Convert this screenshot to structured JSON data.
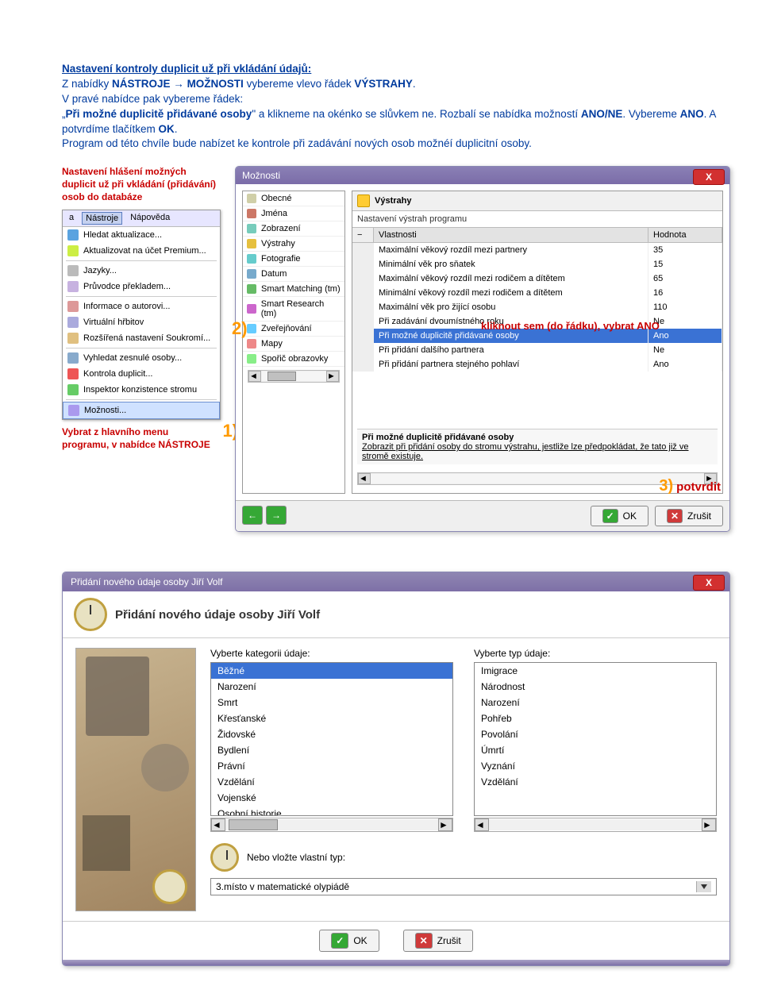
{
  "instructions": {
    "title": "Nastavení kontroly duplicit už při vkládání údajů:",
    "line1a": "Z nabídky ",
    "bold1": "NÁSTROJE",
    "arrow": " → ",
    "bold2": "MOŽNOSTI",
    "line1b": " vybereme vlevo řádek ",
    "bold3": "VÝSTRAHY",
    "line1c": ".",
    "line2": "V pravé nabídce pak vybereme řádek:",
    "line3a": "„",
    "bold4": "Při možné duplicitě přidávané osoby",
    "line3b": "\" a klikneme na okénko se slůvkem ne. Rozbalí se nabídka možností ",
    "bold5": "ANO/NE",
    "line3c": ". Vybereme ",
    "bold6": "ANO",
    "line3d": ". A potvrdíme tlačítkem ",
    "bold7": "OK",
    "line3e": ".",
    "line4": "Program od této chvíle bude nabízet ke kontrole při zadávání nových osob možnéí duplicitní osoby."
  },
  "red_notes": {
    "top_left": "Nastavení hlášení možných duplicit už při vkládání (přidávání) osob do databáze",
    "below_menu_l1": "Vybrat z hlavního menu",
    "below_menu_l2": "programu, v nabídce NÁSTROJE",
    "click_row": "kliknout sem (do řádku), vybrat ANO",
    "confirm": "potvrdit"
  },
  "nums": {
    "n1": "1)",
    "n2": "2)",
    "n3": "3)"
  },
  "menubar": {
    "left": "a",
    "nastroje": "Nástroje",
    "napoveda": "Nápověda"
  },
  "menu_items": [
    "Hledat aktualizace...",
    "Aktualizovat na účet Premium...",
    "Jazyky...",
    "Průvodce překladem...",
    "Informace o autorovi...",
    "Virtuální hřbitov",
    "Rozšířená nastavení Soukromí...",
    "Vyhledat zesnulé osoby...",
    "Kontrola duplicit...",
    "Inspektor konzistence stromu",
    "Možnosti..."
  ],
  "options_dialog": {
    "title": "Možnosti",
    "categories": [
      "Obecné",
      "Jména",
      "Zobrazení",
      "Výstrahy",
      "Fotografie",
      "Datum",
      "Smart Matching (tm)",
      "Smart Research (tm)",
      "Zveřejňování",
      "Mapy",
      "Spořič obrazovky"
    ],
    "selected_cat": "Výstrahy",
    "panel_title": "Výstrahy",
    "panel_sub": "Nastavení výstrah programu",
    "col_prop": "Vlastnosti",
    "col_val": "Hodnota",
    "rows": [
      {
        "p": "Maximální věkový rozdíl mezi partnery",
        "v": "35"
      },
      {
        "p": "Minimální věk pro sňatek",
        "v": "15"
      },
      {
        "p": "Maximální věkový rozdíl mezi rodičem a dítětem",
        "v": "65"
      },
      {
        "p": "Minimální věkový rozdíl mezi rodičem a dítětem",
        "v": "16"
      },
      {
        "p": "Maximální věk pro žijící osobu",
        "v": "110"
      },
      {
        "p": "Při zadávání dvoumístného roku",
        "v": "Ne"
      },
      {
        "p": "Při možné duplicitě přidávané osoby",
        "v": "Ano"
      },
      {
        "p": "Při přidání dalšího partnera",
        "v": "Ne"
      },
      {
        "p": "Při přidání partnera stejného pohlaví",
        "v": "Ano"
      }
    ],
    "hint_title": "Při možné duplicitě přidávané osoby",
    "hint_text": "Zobrazit při přidání osoby do stromu výstrahu, jestliže lze předpokládat, že tato již ve stromě existuje.",
    "ok": "OK",
    "cancel": "Zrušit",
    "prev": "←",
    "next": "→"
  },
  "add_dialog": {
    "title": "Přidání nového údaje osoby Jiří Volf",
    "heading": "Přidání nového údaje osoby Jiří Volf",
    "lbl_cat": "Vyberte kategorii údaje:",
    "lbl_type": "Vyberte typ údaje:",
    "cats": [
      "Běžné",
      "Narození",
      "Smrt",
      "Křesťanské",
      "Židovské",
      "Bydlení",
      "Právní",
      "Vzdělání",
      "Vojenské",
      "Osobní historie"
    ],
    "types": [
      "Imigrace",
      "Národnost",
      "Narození",
      "Pohřeb",
      "Povolání",
      "Úmrtí",
      "Vyznání",
      "Vzdělání"
    ],
    "or_label": "Nebo vložte vlastní typ:",
    "custom_value": "3.místo v matematické olypiádě",
    "ok": "OK",
    "cancel": "Zrušit"
  }
}
